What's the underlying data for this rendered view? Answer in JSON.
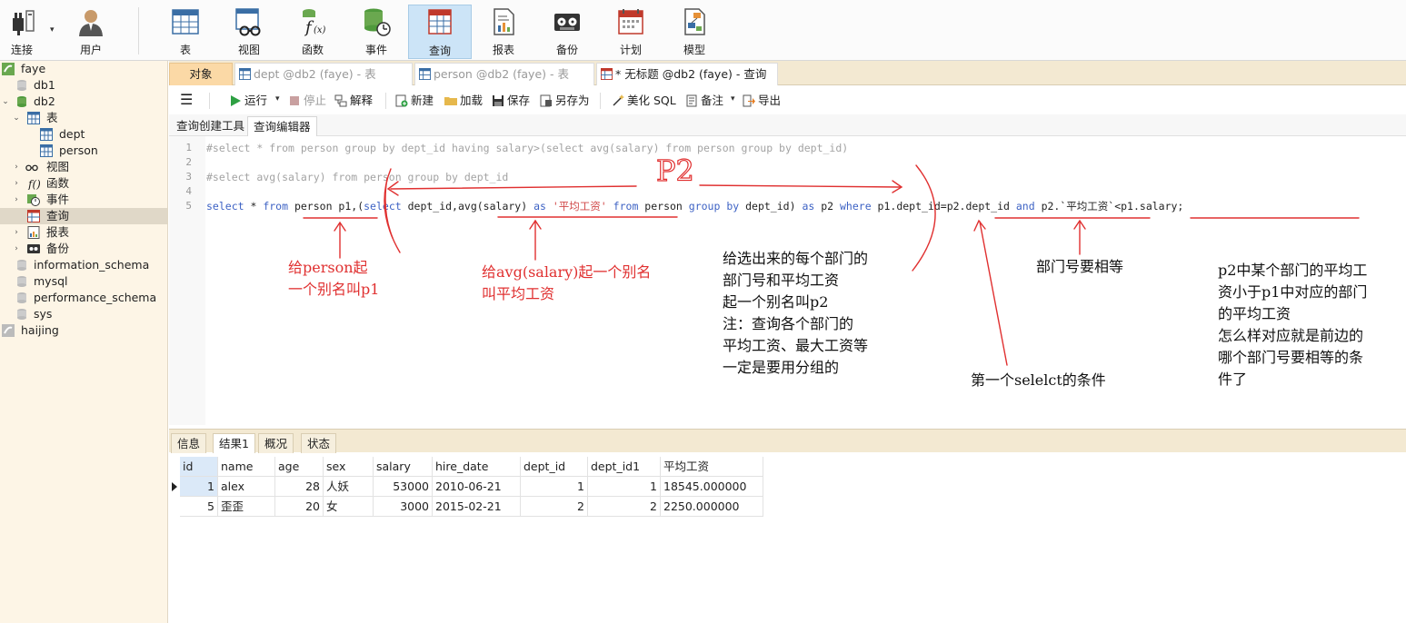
{
  "toolbar": {
    "buttons": [
      {
        "label": "连接",
        "icon": "plug-icon"
      },
      {
        "label": "用户",
        "icon": "user-icon"
      },
      {
        "label": "表",
        "icon": "table-icon"
      },
      {
        "label": "视图",
        "icon": "view-icon"
      },
      {
        "label": "函数",
        "icon": "function-icon"
      },
      {
        "label": "事件",
        "icon": "event-icon"
      },
      {
        "label": "查询",
        "icon": "query-icon"
      },
      {
        "label": "报表",
        "icon": "report-icon"
      },
      {
        "label": "备份",
        "icon": "backup-icon"
      },
      {
        "label": "计划",
        "icon": "calendar-icon"
      },
      {
        "label": "模型",
        "icon": "model-icon"
      }
    ],
    "active": "查询"
  },
  "sidebar": {
    "items": [
      {
        "label": "faye",
        "icon": "connection-icon"
      },
      {
        "label": "db1",
        "icon": "database-icon"
      },
      {
        "label": "db2",
        "icon": "database-icon"
      },
      {
        "label": "表",
        "icon": "table-icon"
      },
      {
        "label": "dept",
        "icon": "table-icon"
      },
      {
        "label": "person",
        "icon": "table-icon"
      },
      {
        "label": "视图",
        "icon": "view-icon"
      },
      {
        "label": "函数",
        "icon": "function-icon"
      },
      {
        "label": "事件",
        "icon": "event-icon"
      },
      {
        "label": "查询",
        "icon": "query-icon"
      },
      {
        "label": "报表",
        "icon": "report-icon"
      },
      {
        "label": "备份",
        "icon": "backup-icon"
      },
      {
        "label": "information_schema",
        "icon": "database-icon"
      },
      {
        "label": "mysql",
        "icon": "database-icon"
      },
      {
        "label": "performance_schema",
        "icon": "database-icon"
      },
      {
        "label": "sys",
        "icon": "database-icon"
      },
      {
        "label": "haijing",
        "icon": "connection-icon"
      }
    ]
  },
  "tabs": {
    "objects": "对象",
    "items": [
      {
        "label": "dept @db2 (faye) - 表"
      },
      {
        "label": "person @db2 (faye) - 表"
      },
      {
        "label": "* 无标题 @db2 (faye) - 查询"
      }
    ]
  },
  "query_toolbar": {
    "run": "运行",
    "stop": "停止",
    "explain": "解释",
    "new": "新建",
    "load": "加载",
    "save": "保存",
    "save_as": "另存为",
    "beautify": "美化 SQL",
    "comment": "备注",
    "export": "导出"
  },
  "subtabs": {
    "builder": "查询创建工具",
    "editor": "查询编辑器"
  },
  "editor": {
    "line_numbers": [
      "1",
      "2",
      "3",
      "4",
      "5"
    ],
    "line1": "#select * from person group by dept_id having salary>(select avg(salary) from person group by dept_id)",
    "line3": "#select avg(salary) from person group by dept_id",
    "line5": {
      "t1": "select",
      "t2": " * ",
      "t3": "from",
      "t4": " person p1,(",
      "t5": "select",
      "t6": " dept_id,avg(salary) ",
      "t7": "as",
      "t8": " ",
      "t9": "'平均工资'",
      "t10": " ",
      "t11": "from",
      "t12": " person ",
      "t13": "group",
      "t14": " ",
      "t15": "by",
      "t16": " dept_id) ",
      "t17": "as",
      "t18": " p2 ",
      "t19": "where",
      "t20": " p1.dept_id=p2.dept_id ",
      "t21": "and",
      "t22": " p2.`平均工资`<p1.salary;"
    }
  },
  "annotations": {
    "p2_mark": "P2",
    "note_person": [
      "给person起",
      "一个别名叫p1"
    ],
    "note_avg": [
      "给avg(salary)起一个别名",
      "叫平均工资"
    ],
    "note_p2": [
      "给选出来的每个部门的",
      "部门号和平均工资",
      "起一个别名叫p2",
      "注：查询各个部门的",
      "平均工资、最大工资等",
      "一定是要用分组的"
    ],
    "note_where": [
      "第一个selelct的条件"
    ],
    "note_dept": [
      "部门号要相等"
    ],
    "note_avg_cmp": [
      "p2中某个部门的平均工",
      "资小于p1中对应的部门",
      "的平均工资",
      "怎么样对应就是前边的",
      "哪个部门号要相等的条",
      "件了"
    ]
  },
  "result_tabs": {
    "items": [
      "信息",
      "结果1",
      "概况",
      "状态"
    ],
    "active": "结果1"
  },
  "grid": {
    "columns": [
      "id",
      "name",
      "age",
      "sex",
      "salary",
      "hire_date",
      "dept_id",
      "dept_id1",
      "平均工资"
    ],
    "rows": [
      [
        "1",
        "alex",
        "28",
        "人妖",
        "53000",
        "2010-06-21",
        "1",
        "1",
        "18545.000000"
      ],
      [
        "5",
        "歪歪",
        "20",
        "女",
        "3000",
        "2015-02-21",
        "2",
        "2",
        "2250.000000"
      ]
    ]
  },
  "colors": {
    "sidebar_bg": "#fdf5e6",
    "tab_strip_bg": "#f3e9d2",
    "object_tab_bg": "#fbd9a6",
    "keyword": "#3d62c4",
    "string": "#d04848",
    "annotation_red": "#e03030"
  }
}
